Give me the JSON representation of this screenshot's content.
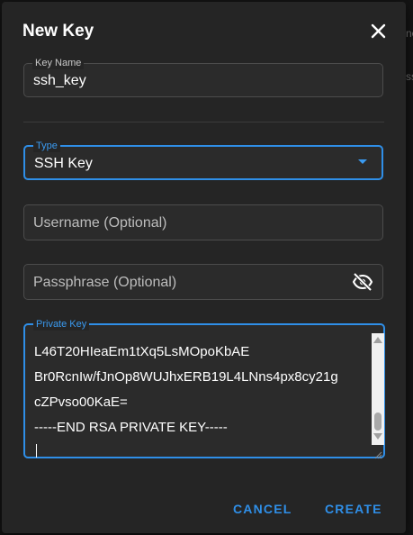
{
  "background": {
    "peek_text_1": "ne",
    "peek_text_2": "ss"
  },
  "dialog": {
    "title": "New Key",
    "close_icon": "close-icon",
    "key_name": {
      "label": "Key Name",
      "value": "ssh_key"
    },
    "type": {
      "label": "Type",
      "value": "SSH Key",
      "icon": "chevron-down-icon"
    },
    "username": {
      "placeholder": "Username (Optional)"
    },
    "passphrase": {
      "placeholder": "Passphrase (Optional)",
      "icon": "eye-off-icon"
    },
    "private_key": {
      "label": "Private Key",
      "lines": [
        "L46T20HIeaEm1tXq5LsMOpoKbAE",
        "Br0RcnIw/fJnOp8WUJhxERB19L4LNns4px8cy21g",
        "cZPvso00KaE=",
        "-----END RSA PRIVATE KEY-----"
      ]
    },
    "buttons": {
      "cancel": "CANCEL",
      "create": "CREATE"
    }
  },
  "colors": {
    "accent": "#2f8fe8",
    "dialog_bg": "#252525",
    "field_bg": "#2b2b2b"
  }
}
